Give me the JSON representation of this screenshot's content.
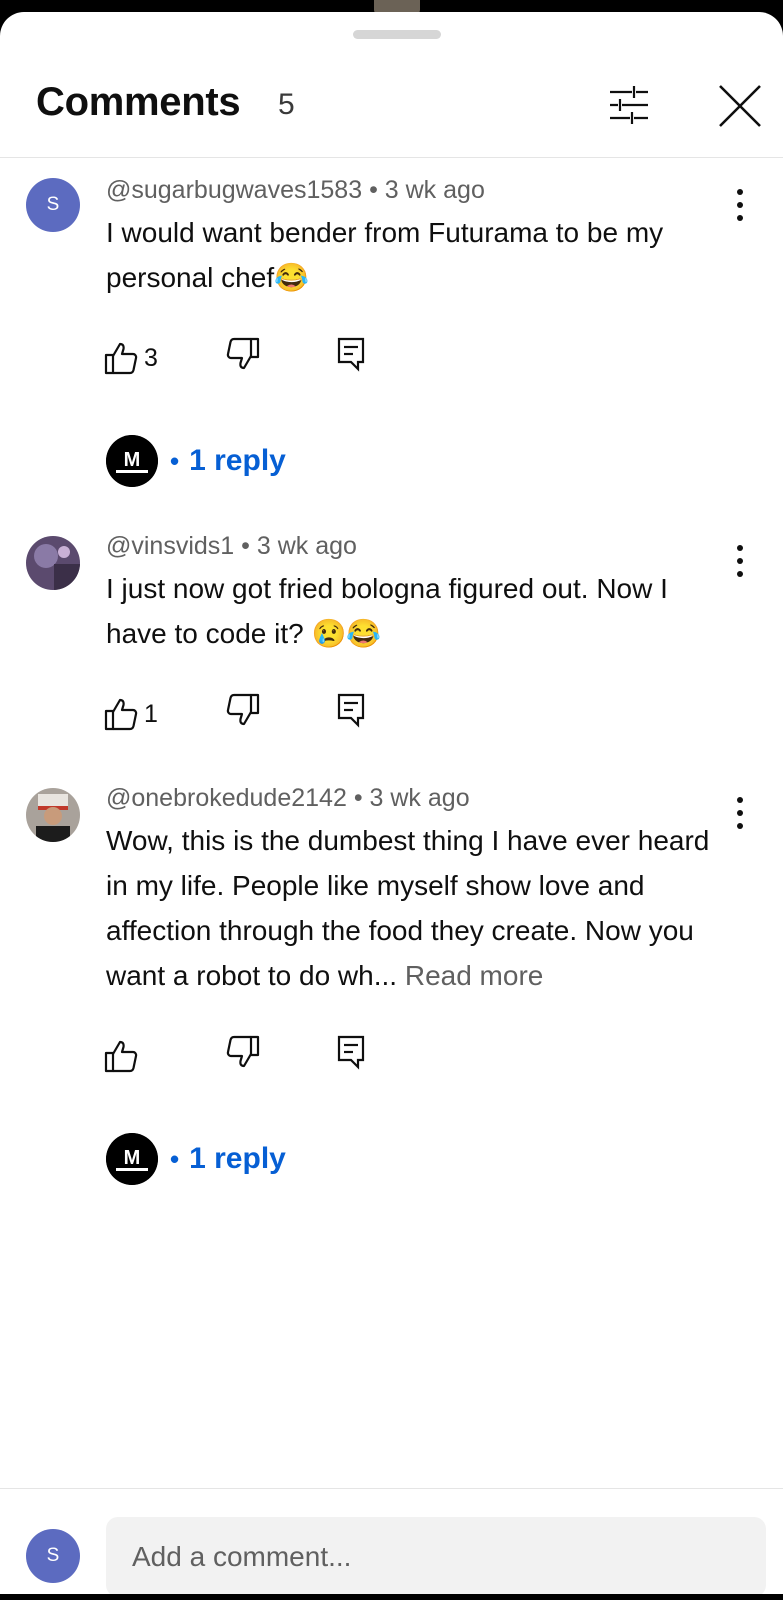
{
  "header": {
    "title": "Comments",
    "count": "5",
    "filter_icon": "sliders-icon",
    "close_icon": "close-icon"
  },
  "comments": [
    {
      "avatar_letter": "S",
      "author": "@sugarbugwaves1583",
      "time": "3 wk ago",
      "text": "I would want bender from Futurama to be my personal chef😂",
      "read_more": "",
      "likes": "3",
      "replies": "1 reply"
    },
    {
      "avatar_letter": "",
      "author": "@vinsvids1",
      "time": "3 wk ago",
      "text": "I just now got fried bologna figured out. Now I have to code it? 😢😂",
      "read_more": "",
      "likes": "1",
      "replies": ""
    },
    {
      "avatar_letter": "",
      "author": "@onebrokedude2142",
      "time": "3 wk ago",
      "text": "Wow, this is the dumbest thing I have ever heard in my life. People like myself show love and affection through the food they create. Now you want a robot to do wh...",
      "read_more": "Read more",
      "likes": "",
      "replies": "1 reply"
    }
  ],
  "separator": "•",
  "replies_logo_letter": "M",
  "footer": {
    "avatar_letter": "S",
    "placeholder": "Add a comment..."
  },
  "colors": {
    "accent_link": "#065fd4",
    "avatar_bg": "#5c6bc0",
    "secondary_text": "#606060"
  }
}
